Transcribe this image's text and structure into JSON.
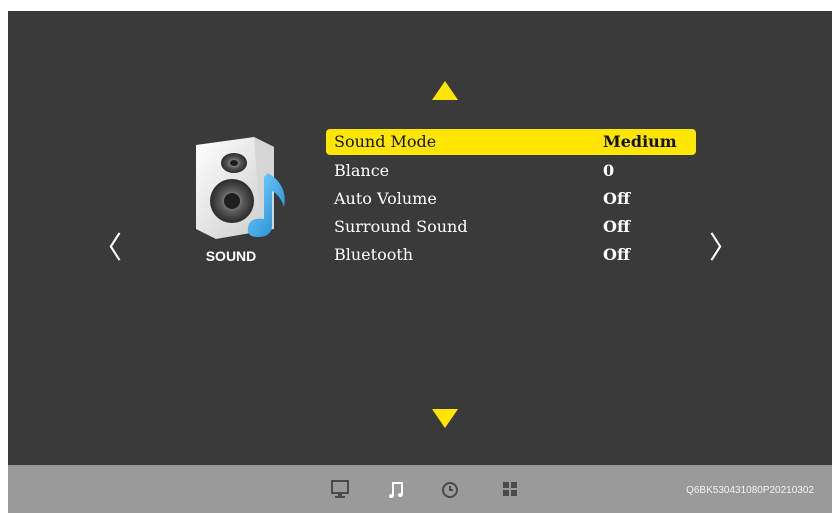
{
  "category": {
    "label": "SOUND",
    "icon": "speaker-music-icon"
  },
  "navigation": {
    "prev_glyph": "〈",
    "next_glyph": "〉",
    "up_icon": "triangle-up-icon",
    "down_icon": "triangle-down-icon"
  },
  "menu": {
    "items": [
      {
        "label": "Sound Mode",
        "value": "Medium",
        "selected": true
      },
      {
        "label": "Blance",
        "value": "0",
        "selected": false
      },
      {
        "label": "Auto Volume",
        "value": "Off",
        "selected": false
      },
      {
        "label": "Surround Sound",
        "value": "Off",
        "selected": false
      },
      {
        "label": "Bluetooth",
        "value": "Off",
        "selected": false
      }
    ]
  },
  "bottom_bar": {
    "icons": [
      "picture-icon",
      "music-note-icon",
      "clock-icon",
      "grid-icon"
    ],
    "active_icon": "music-note-icon",
    "model_code": "Q6BK530431080P20210302"
  },
  "colors": {
    "highlight": "#ffe600",
    "background": "#3a3a3a",
    "bar": "#9a9a9a"
  }
}
